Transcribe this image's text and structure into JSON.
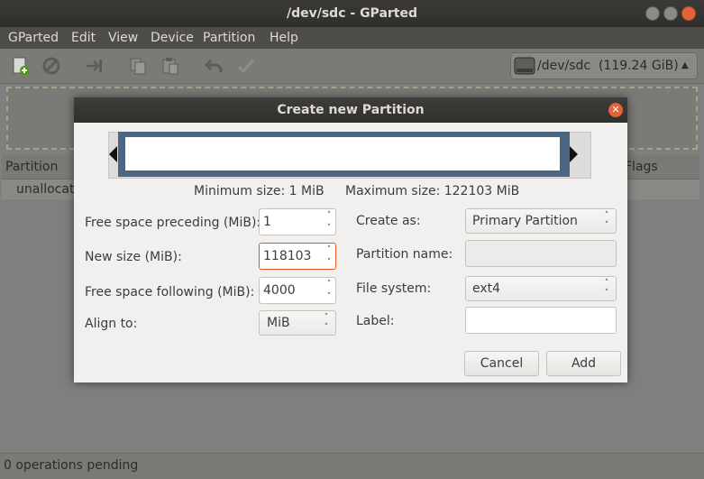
{
  "window": {
    "title": "/dev/sdc - GParted"
  },
  "menu": [
    "GParted",
    "Edit",
    "View",
    "Device",
    "Partition",
    "Help"
  ],
  "toolbar": {
    "icons": [
      "new-partition-icon",
      "delete-icon",
      "resize-move-icon",
      "copy-icon",
      "paste-icon",
      "undo-icon",
      "apply-icon"
    ],
    "device": {
      "path": "/dev/sdc",
      "size": "(119.24 GiB)"
    }
  },
  "list": {
    "columns": [
      "Partition",
      "Flags"
    ],
    "rows": [
      {
        "partition": "unallocated"
      }
    ]
  },
  "status": {
    "text": "0 operations pending"
  },
  "dialog": {
    "title": "Create new Partition",
    "min_size": "Minimum size: 1 MiB",
    "max_size": "Maximum size: 122103 MiB",
    "fields": {
      "free_preceding": {
        "label": "Free space preceding (MiB):",
        "value": "1"
      },
      "new_size": {
        "label": "New size (MiB):",
        "value": "118103"
      },
      "free_following": {
        "label": "Free space following (MiB):",
        "value": "4000"
      },
      "align_to": {
        "label": "Align to:",
        "value": "MiB"
      },
      "create_as": {
        "label": "Create as:",
        "value": "Primary Partition"
      },
      "partition_name": {
        "label": "Partition name:",
        "value": ""
      },
      "file_system": {
        "label": "File system:",
        "value": "ext4"
      },
      "label": {
        "label": "Label:",
        "value": ""
      }
    },
    "buttons": {
      "cancel": "Cancel",
      "add": "Add"
    }
  }
}
